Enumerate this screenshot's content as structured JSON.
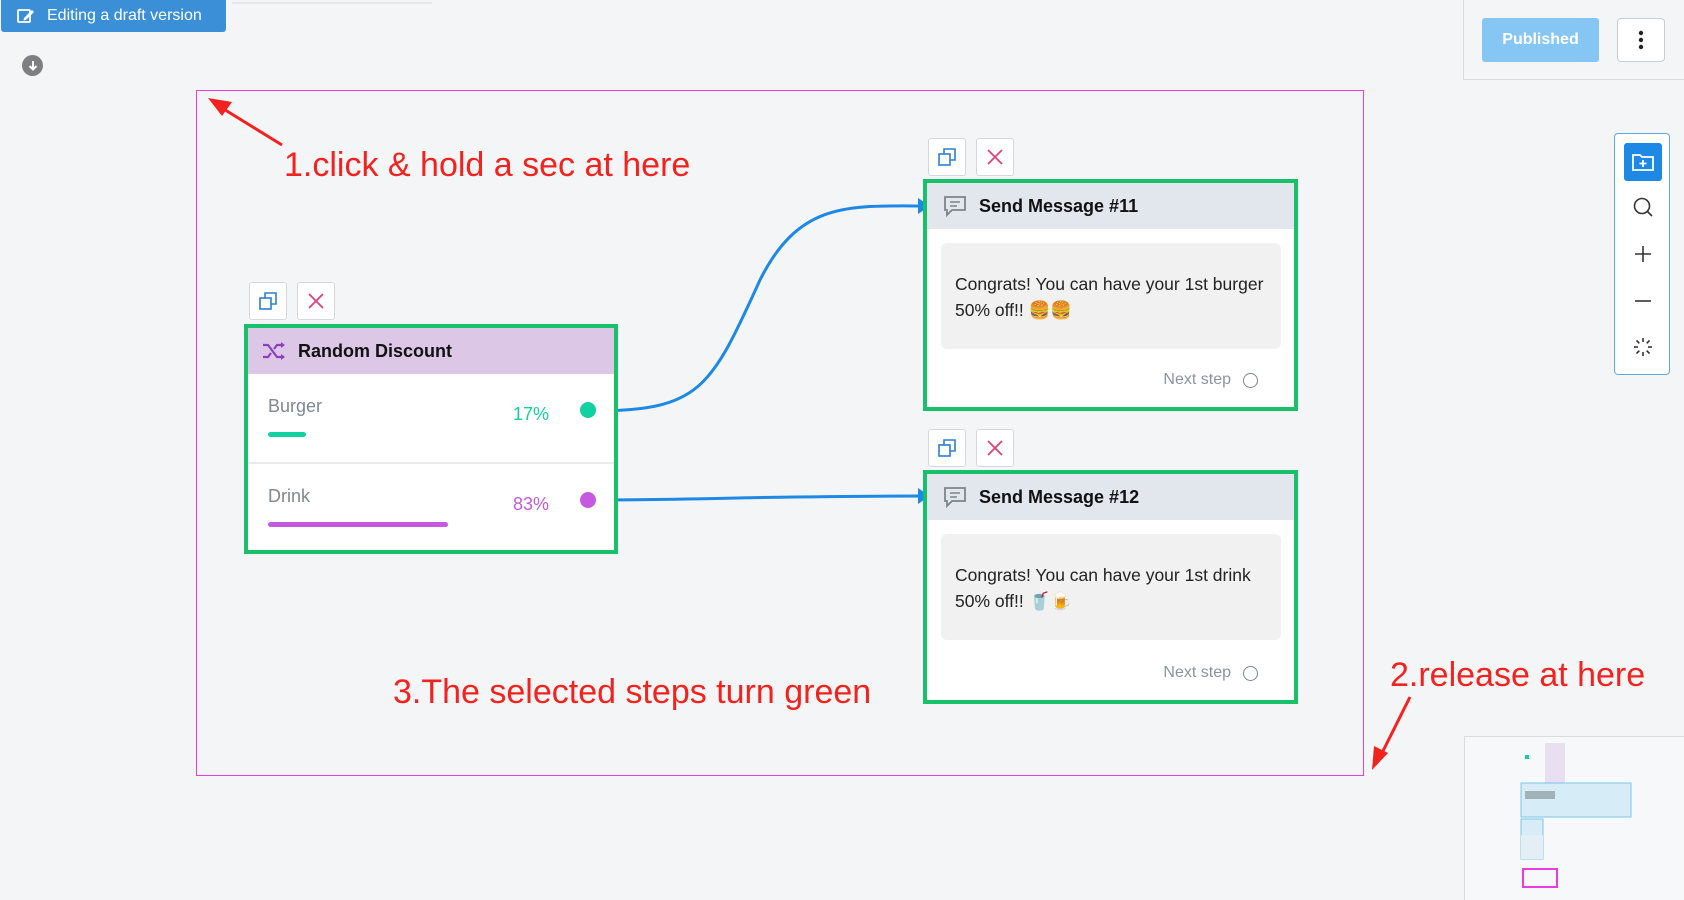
{
  "header": {
    "draft_label": "Editing a draft version",
    "published_label": "Published"
  },
  "annotations": {
    "step1": "1.click & hold a sec at here",
    "step2": "2.release at here",
    "step3": "3.The selected steps turn green"
  },
  "random_discount": {
    "title": "Random Discount",
    "branches": [
      {
        "label": "Burger",
        "percent_text": "17%",
        "percent": 17,
        "color": "#12d1a0"
      },
      {
        "label": "Drink",
        "percent_text": "83%",
        "percent": 83,
        "color": "#c35ae0"
      }
    ]
  },
  "messages": [
    {
      "title": "Send Message #11",
      "line1": "Congrats! You can have your 1st burger",
      "line2": "50% off!! 🍔🍔",
      "next_step": "Next step"
    },
    {
      "title": "Send Message #12",
      "line1": "Congrats! You can have your 1st drink",
      "line2": "50% off!! 🥤🍺",
      "next_step": "Next step"
    }
  ],
  "colors": {
    "selected_border": "#18c06a",
    "selection_rect": "#e83ee0",
    "link": "#1e88e5",
    "annotation": "#f2231f"
  },
  "icons": {
    "draft": "edit-icon",
    "download": "arrow-down-circle-icon",
    "more": "kebab-menu-icon",
    "toolbar": [
      "add-folder-icon",
      "search-icon",
      "zoom-in-icon",
      "zoom-out-icon",
      "auto-layout-icon"
    ],
    "node_actions": [
      "duplicate-icon",
      "delete-icon"
    ],
    "random": "shuffle-icon",
    "message": "chat-bubble-icon"
  }
}
